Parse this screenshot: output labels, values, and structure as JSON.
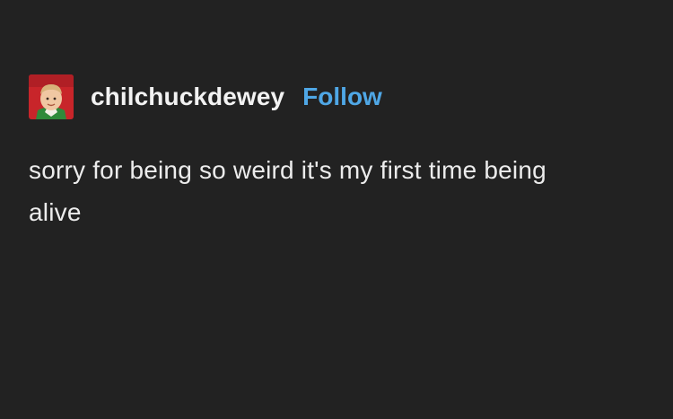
{
  "post": {
    "avatar_icon": "user-avatar-photo",
    "username": "chilchuckdewey",
    "follow_label": "Follow",
    "text": "sorry for being so weird it's my first time being alive"
  },
  "colors": {
    "background": "#222222",
    "text": "#ececec",
    "follow": "#4fa7e6"
  }
}
